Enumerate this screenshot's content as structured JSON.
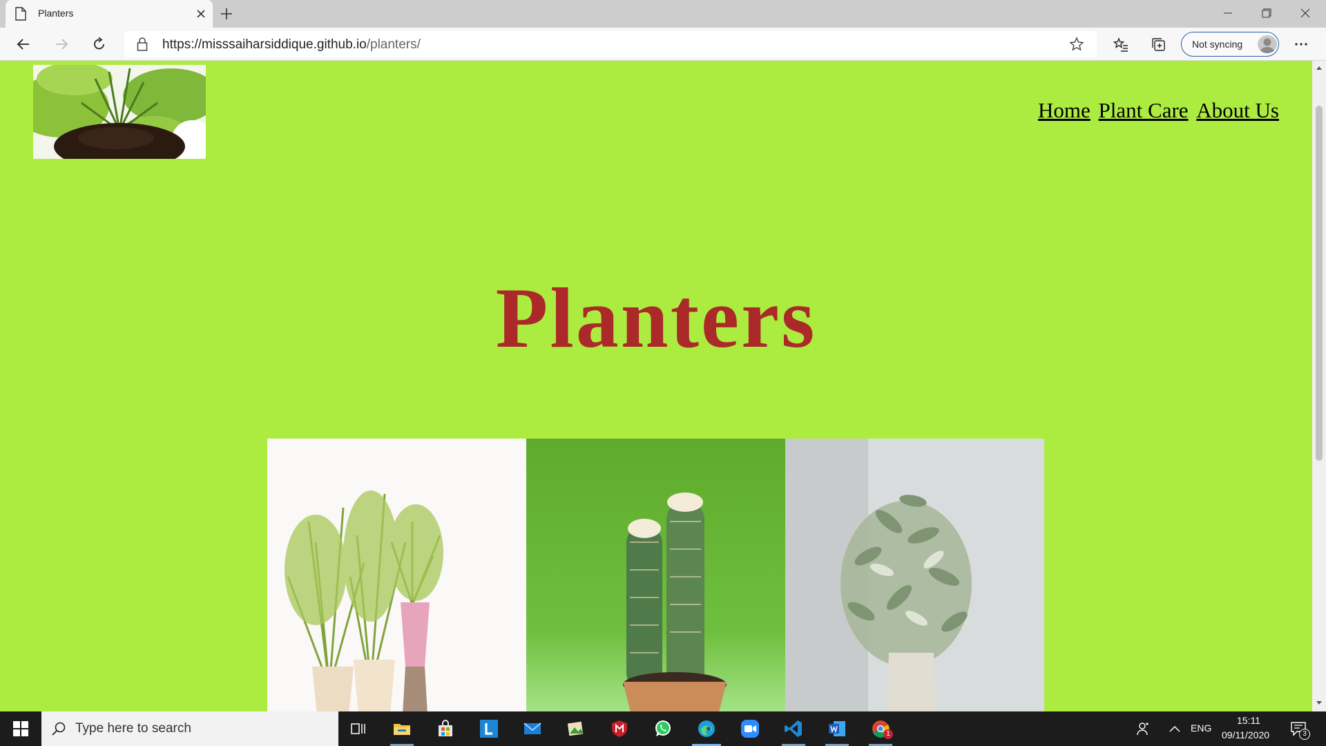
{
  "browser": {
    "tab": {
      "title": "Planters"
    },
    "address": {
      "url_host": "https://misssaiharsiddique.github.io",
      "url_path": "/planters/"
    },
    "profile": {
      "sync_label": "Not syncing"
    }
  },
  "page": {
    "nav": [
      {
        "label": "Home"
      },
      {
        "label": "Plant Care"
      },
      {
        "label": "About Us"
      }
    ],
    "hero_title": "Planters",
    "gallery": [
      {
        "icon": "palms-in-pots-image"
      },
      {
        "icon": "cactus-in-pot-image"
      },
      {
        "icon": "olive-plant-in-vase-image"
      }
    ]
  },
  "taskbar": {
    "search_placeholder": "Type here to search",
    "apps": [
      "task-view",
      "file-explorer",
      "microsoft-store",
      "app-l",
      "mail",
      "photos",
      "mcafee",
      "whatsapp",
      "edge",
      "zoom",
      "vscode",
      "word",
      "chrome-ext"
    ],
    "language": "ENG",
    "time": "15:11",
    "date": "09/11/2020",
    "notification_count": "3",
    "app_badge": "1"
  },
  "colors": {
    "page_background": "#acec40",
    "title_color": "#ab2929",
    "taskbar": "#1c1c1c"
  }
}
